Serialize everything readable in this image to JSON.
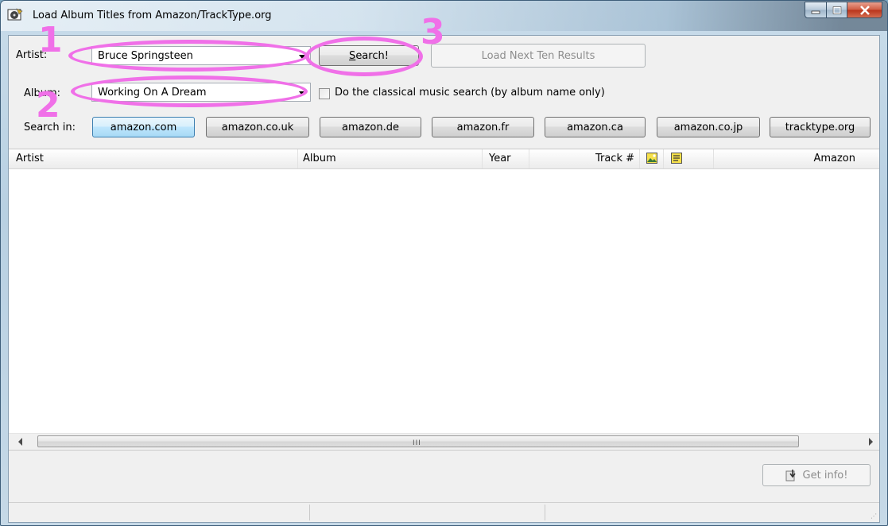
{
  "window": {
    "title": "Load Album Titles from Amazon/TrackType.org",
    "controls": [
      "minimize",
      "maximize",
      "close"
    ]
  },
  "form": {
    "artist_label": "Artist:",
    "artist_value": "Bruce Springsteen",
    "album_label": "Album:",
    "album_value": "Working On A Dream",
    "search_button": "Search!",
    "load_next_button": "Load Next Ten Results",
    "classical_checkbox_label": "Do the classical music search (by album name only)",
    "classical_checked": false,
    "search_in_label": "Search in:",
    "sources": [
      {
        "label": "amazon.com",
        "active": true
      },
      {
        "label": "amazon.co.uk",
        "active": false
      },
      {
        "label": "amazon.de",
        "active": false
      },
      {
        "label": "amazon.fr",
        "active": false
      },
      {
        "label": "amazon.ca",
        "active": false
      },
      {
        "label": "amazon.co.jp",
        "active": false
      },
      {
        "label": "tracktype.org",
        "active": false
      }
    ]
  },
  "results": {
    "columns": [
      "Artist",
      "Album",
      "Year",
      "Track #",
      "cover-image-icon",
      "notes-icon",
      "Amazon"
    ],
    "rows": []
  },
  "footer": {
    "get_info_button": "Get info!",
    "scrollbar_grip": "III"
  },
  "annotations": [
    {
      "number": "1",
      "target": "artist-combo"
    },
    {
      "number": "2",
      "target": "album-combo"
    },
    {
      "number": "3",
      "target": "search-button"
    }
  ],
  "colors": {
    "annotation": "#f070e8",
    "active_source": "#bee6fd"
  }
}
